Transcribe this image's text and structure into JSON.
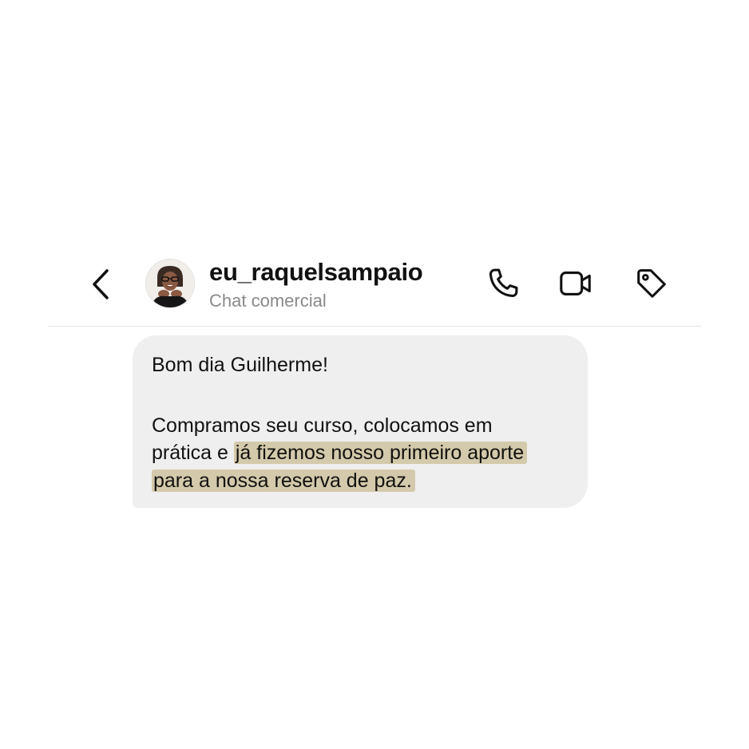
{
  "header": {
    "username": "eu_raquelsampaio",
    "subtitle": "Chat comercial",
    "icons": {
      "back": "chevron-left-icon",
      "call": "phone-icon",
      "video": "video-camera-icon",
      "label": "tag-icon"
    }
  },
  "message": {
    "greeting": "Bom dia Guilherme!",
    "line2": "Compramos seu curso, colocamos em",
    "line3_plain": "prática e",
    "line3_highlight": "já fizemos nosso primeiro aporte",
    "line4_highlight": "para a nossa reserva de paz.",
    "highlight_color": "#c4b280",
    "bubble_color": "#efefef"
  }
}
